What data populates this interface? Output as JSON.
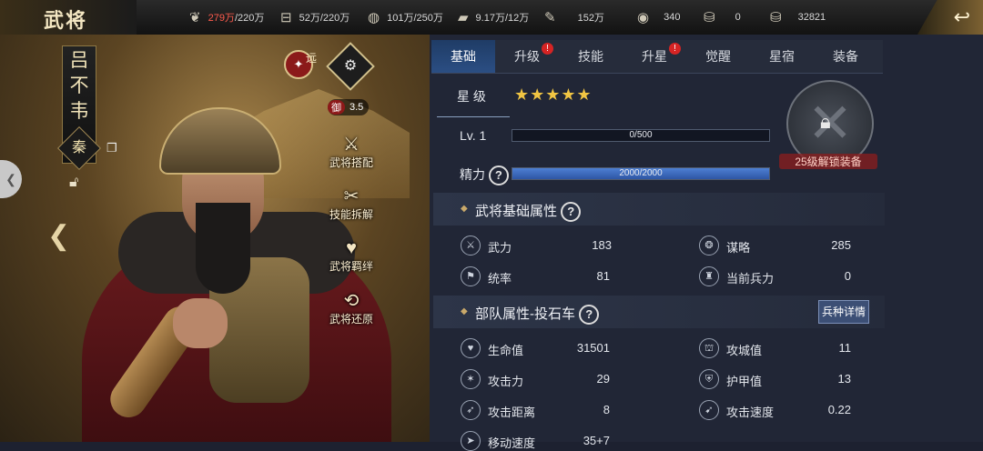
{
  "header": {
    "title": "武将",
    "resources": [
      {
        "icon": "grain-icon",
        "current": "279万",
        "max": "/220万"
      },
      {
        "icon": "wood-icon",
        "current": "52万",
        "max": "/220万"
      },
      {
        "icon": "stone-icon",
        "current": "101万",
        "max": "/250万"
      },
      {
        "icon": "iron-icon",
        "current": "9.17万",
        "max": "/12万"
      },
      {
        "icon": "decree-icon",
        "current": "152万",
        "max": ""
      },
      {
        "icon": "copper-coin-icon",
        "current": "340",
        "max": ""
      },
      {
        "icon": "gold-ingot-icon",
        "current": "0",
        "max": ""
      },
      {
        "icon": "silver-ingot-icon",
        "current": "32821",
        "max": ""
      }
    ],
    "back_icon": "back-arrow-icon"
  },
  "hero": {
    "name_chars": [
      "吕",
      "不",
      "韦"
    ],
    "faction": "秦",
    "type_label": "远",
    "defense_key": "御",
    "defense_value": "3.5",
    "actions": [
      {
        "label": "武将搭配",
        "icon": "pairing-icon"
      },
      {
        "label": "技能拆解",
        "icon": "skill-dismantle-icon"
      },
      {
        "label": "武将羁绊",
        "icon": "bond-heart-icon"
      },
      {
        "label": "武将还原",
        "icon": "restore-icon"
      }
    ]
  },
  "tabs": [
    {
      "label": "基础",
      "active": true,
      "alert": false
    },
    {
      "label": "升级",
      "active": false,
      "alert": true
    },
    {
      "label": "技能",
      "active": false,
      "alert": false
    },
    {
      "label": "升星",
      "active": false,
      "alert": true
    },
    {
      "label": "觉醒",
      "active": false,
      "alert": false
    },
    {
      "label": "星宿",
      "active": false,
      "alert": false
    },
    {
      "label": "装备",
      "active": false,
      "alert": false
    }
  ],
  "stars": {
    "label": "星 级",
    "count": 5,
    "display": "★★★★★"
  },
  "level": {
    "label": "Lv. 1",
    "text": "0/500",
    "fraction": 0.0
  },
  "energy": {
    "label": "精力",
    "text": "2000/2000",
    "fraction": 1.0
  },
  "equipment_lock": {
    "text": "25级解锁装备"
  },
  "base_section": {
    "title": "武将基础属性",
    "stats": [
      {
        "icon": "force-icon",
        "label": "武力",
        "value": "183"
      },
      {
        "icon": "strategy-icon",
        "label": "谋略",
        "value": "285"
      },
      {
        "icon": "command-icon",
        "label": "统率",
        "value": "81"
      },
      {
        "icon": "troops-icon",
        "label": "当前兵力",
        "value": "0"
      }
    ]
  },
  "troop_section": {
    "title": "部队属性-投石车",
    "detail_button": "兵种详情",
    "stats": [
      {
        "icon": "hp-icon",
        "label": "生命值",
        "value": "31501"
      },
      {
        "icon": "siege-icon",
        "label": "攻城值",
        "value": "11"
      },
      {
        "icon": "attack-icon",
        "label": "攻击力",
        "value": "29"
      },
      {
        "icon": "armor-icon",
        "label": "护甲值",
        "value": "13"
      },
      {
        "icon": "range-icon",
        "label": "攻击距离",
        "value": "8"
      },
      {
        "icon": "speed-icon",
        "label": "攻击速度",
        "value": "0.22"
      },
      {
        "icon": "move-icon",
        "label": "移动速度",
        "value": "35+7"
      }
    ]
  }
}
